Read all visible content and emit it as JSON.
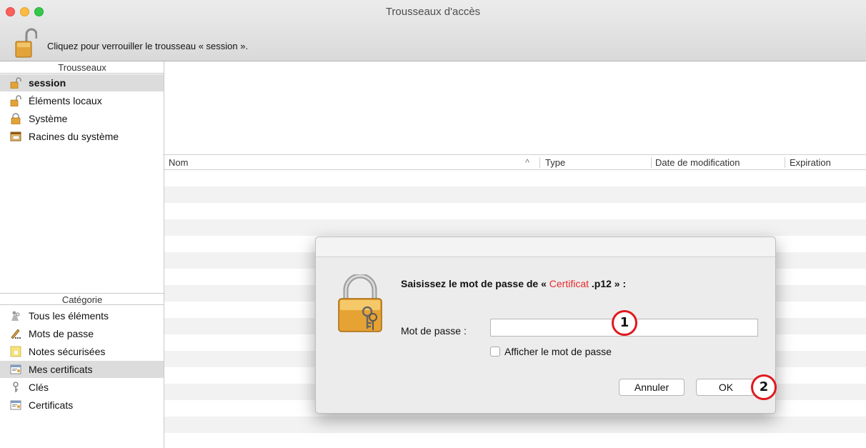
{
  "window": {
    "title": "Trousseaux d'accès",
    "toolbar_text": "Cliquez pour verrouiller le trousseau « session »."
  },
  "sidebar": {
    "keychains_header": "Trousseaux",
    "keychains": [
      {
        "label": "session",
        "icon": "unlocked-padlock-icon",
        "selected": true
      },
      {
        "label": "Éléments locaux",
        "icon": "unlocked-padlock-icon"
      },
      {
        "label": "Système",
        "icon": "locked-padlock-icon"
      },
      {
        "label": "Racines du système",
        "icon": "cabinet-icon"
      }
    ],
    "category_header": "Catégorie",
    "categories": [
      {
        "label": "Tous les éléments",
        "icon": "people-keys-icon"
      },
      {
        "label": "Mots de passe",
        "icon": "pen-dots-icon"
      },
      {
        "label": "Notes sécurisées",
        "icon": "note-lock-icon"
      },
      {
        "label": "Mes certificats",
        "icon": "certificate-icon",
        "selected": true
      },
      {
        "label": "Clés",
        "icon": "key-icon"
      },
      {
        "label": "Certificats",
        "icon": "certificate-icon"
      }
    ]
  },
  "table": {
    "columns": [
      "Nom",
      "Type",
      "Date de modification",
      "Expiration"
    ],
    "sort_indicator": "^"
  },
  "dialog": {
    "prompt_prefix": "Saisissez le mot de passe de «",
    "prompt_file_highlight": "Certificat",
    "prompt_suffix": ".p12 » :",
    "password_label": "Mot de passe :",
    "password_value": "",
    "show_password_label": "Afficher le mot de passe",
    "cancel_label": "Annuler",
    "ok_label": "OK"
  },
  "annotations": [
    "1",
    "2"
  ],
  "colors": {
    "annotation_red": "#e0191e",
    "highlight_red": "#e8292b",
    "selection_gray": "#dcdcdc"
  }
}
